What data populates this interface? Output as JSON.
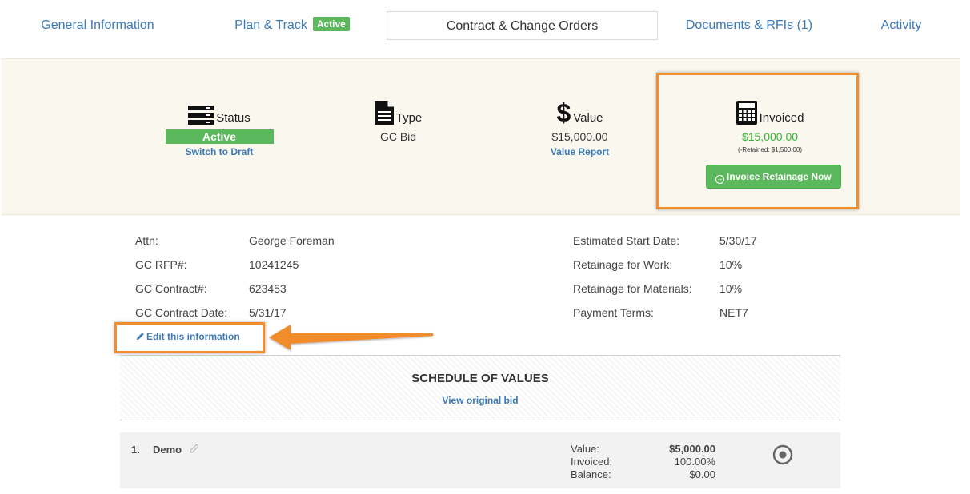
{
  "tabs": {
    "general": "General Information",
    "plan": "Plan & Track",
    "plan_badge": "Active",
    "contract": "Contract & Change Orders",
    "docs": "Documents & RFIs (1)",
    "activity": "Activity"
  },
  "summary": {
    "status_label": "Status",
    "status_value": "Active",
    "status_link": "Switch to Draft",
    "type_label": "Type",
    "type_value": "GC Bid",
    "value_label": "Value",
    "value_amount": "$15,000.00",
    "value_link": "Value Report",
    "invoiced_label": "Invoiced",
    "invoiced_amount": "$15,000.00",
    "retained": "(-Retained: $1,500.00)",
    "invoice_button": "Invoice Retainage Now"
  },
  "details": {
    "left": [
      {
        "label": "Attn:",
        "value": "George Foreman"
      },
      {
        "label": "GC RFP#:",
        "value": "10241245"
      },
      {
        "label": "GC Contract#:",
        "value": "623453"
      },
      {
        "label": "GC Contract Date:",
        "value": "5/31/17"
      }
    ],
    "right": [
      {
        "label": "Estimated Start Date:",
        "value": "5/30/17"
      },
      {
        "label": "Retainage for Work:",
        "value": "10%"
      },
      {
        "label": "Retainage for Materials:",
        "value": "10%"
      },
      {
        "label": "Payment Terms:",
        "value": "NET7"
      }
    ],
    "edit_link": "Edit this information"
  },
  "sov": {
    "title": "SCHEDULE OF VALUES",
    "link": "View original bid",
    "items": [
      {
        "number": "1.",
        "name": "Demo",
        "value_label": "Value:",
        "value": "$5,000.00",
        "invoiced_label": "Invoiced:",
        "invoiced": "100.00%",
        "balance_label": "Balance:",
        "balance": "$0.00"
      }
    ]
  },
  "colors": {
    "link": "#3d7ab8",
    "success": "#5cb85c",
    "highlight": "#f08d2c",
    "panel_bg": "#faf8ee"
  }
}
